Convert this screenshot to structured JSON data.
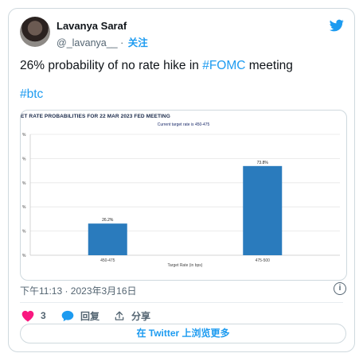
{
  "user": {
    "display_name": "Lavanya Saraf",
    "handle": "@_lavanya__",
    "separator": " · ",
    "follow_label": "关注"
  },
  "tweet": {
    "text_prefix": "26% probability of no rate hike in ",
    "text_hashtag": "#FOMC",
    "text_suffix": " meeting",
    "hashtag_line": "#btc",
    "timestamp": "下午11:13 · 2023年3月16日"
  },
  "actions": {
    "like_count": "3",
    "reply_label": "回复",
    "share_label": "分享",
    "read_more_label": "在 Twitter 上浏览更多"
  },
  "colors": {
    "accent": "#1d9bf0",
    "like": "#f91880",
    "bar": "#2a7bbd"
  },
  "icons": {
    "brand": "twitter-bird-icon",
    "info": "info-icon",
    "like": "heart-icon",
    "reply": "speech-bubble-icon",
    "share": "share-icon"
  },
  "chart_data": {
    "type": "bar",
    "title": "ET RATE PROBABILITIES FOR 22 MAR 2023 FED MEETING",
    "subtitle": "Current target rate is 450-475",
    "categories": [
      "450-475",
      "475-500"
    ],
    "values": [
      26.2,
      73.8
    ],
    "value_labels": [
      "26.2%",
      "73.8%"
    ],
    "xlabel": "Target Rate (in bps)",
    "ylabel": "",
    "ytick_labels": [
      "%",
      "%",
      "%",
      "%",
      "%",
      "%"
    ],
    "ylim": [
      0,
      100
    ],
    "grid": true,
    "legend": "none"
  }
}
